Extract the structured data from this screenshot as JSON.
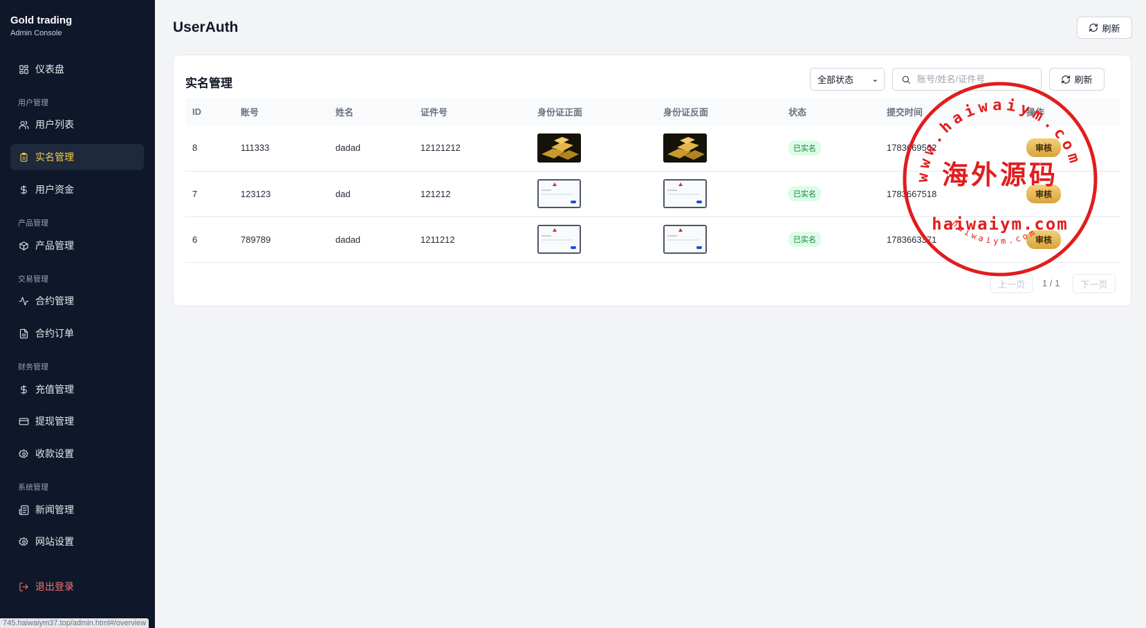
{
  "brand": {
    "title": "Gold trading",
    "subtitle": "Admin Console"
  },
  "sidebar": {
    "sections": [
      "用户管理",
      "产品管理",
      "交易管理",
      "财务管理",
      "系统管理"
    ],
    "items": [
      {
        "label": "仪表盘",
        "icon": "dashboard-icon"
      },
      {
        "label": "用户列表",
        "icon": "users-icon"
      },
      {
        "label": "实名管理",
        "icon": "clipboard-icon",
        "active": true
      },
      {
        "label": "用户资金",
        "icon": "dollar-icon"
      },
      {
        "label": "产品管理",
        "icon": "box-icon"
      },
      {
        "label": "合约管理",
        "icon": "activity-icon"
      },
      {
        "label": "合约订单",
        "icon": "file-icon"
      },
      {
        "label": "充值管理",
        "icon": "dollar-icon"
      },
      {
        "label": "提现管理",
        "icon": "card-icon"
      },
      {
        "label": "收款设置",
        "icon": "settings-icon"
      },
      {
        "label": "新闻管理",
        "icon": "news-icon"
      },
      {
        "label": "网站设置",
        "icon": "settings-icon"
      }
    ],
    "logout_label": "退出登录"
  },
  "header": {
    "title": "UserAuth",
    "refresh_label": "刷新"
  },
  "card": {
    "title": "实名管理",
    "status_filter": "全部状态",
    "search_placeholder": "账号/姓名/证件号",
    "refresh_label": "刷新"
  },
  "table": {
    "columns": [
      "ID",
      "账号",
      "姓名",
      "证件号",
      "身份证正面",
      "身份证反面",
      "状态",
      "提交时间",
      "操作"
    ],
    "rows": [
      {
        "id": "8",
        "account": "111333",
        "name": "dadad",
        "id_number": "12121212",
        "front": "gold-bars-image",
        "back": "gold-bars-image",
        "status": "已实名",
        "submitted": "1783669562",
        "action": "审核"
      },
      {
        "id": "7",
        "account": "123123",
        "name": "dad",
        "id_number": "121212",
        "front": "document-screenshot",
        "back": "document-screenshot",
        "status": "已实名",
        "submitted": "1783667518",
        "action": "审核"
      },
      {
        "id": "6",
        "account": "789789",
        "name": "dadad",
        "id_number": "1211212",
        "front": "document-screenshot",
        "back": "document-screenshot",
        "status": "已实名",
        "submitted": "1783663371",
        "action": "审核"
      }
    ]
  },
  "pagination": {
    "prev_label": "上一页",
    "info": "1 / 1",
    "next_label": "下一页"
  },
  "watermark": {
    "arc_top": "www.haiwaiym.com",
    "center": "海外源码",
    "bottom": "haiwaiym.com",
    "arc_bottom": "haiwaiym.com",
    "color": "#e11d1d"
  },
  "status_bar": {
    "url": "745.haiwaiym37.top/admin.html#/overview"
  },
  "colors": {
    "sidebar_bg": "#0f172a",
    "active_text": "#f5c94a",
    "logout": "#f87171",
    "badge_bg": "#dcfce7",
    "badge_text": "#15803d",
    "review_btn": "#e0ac47"
  }
}
